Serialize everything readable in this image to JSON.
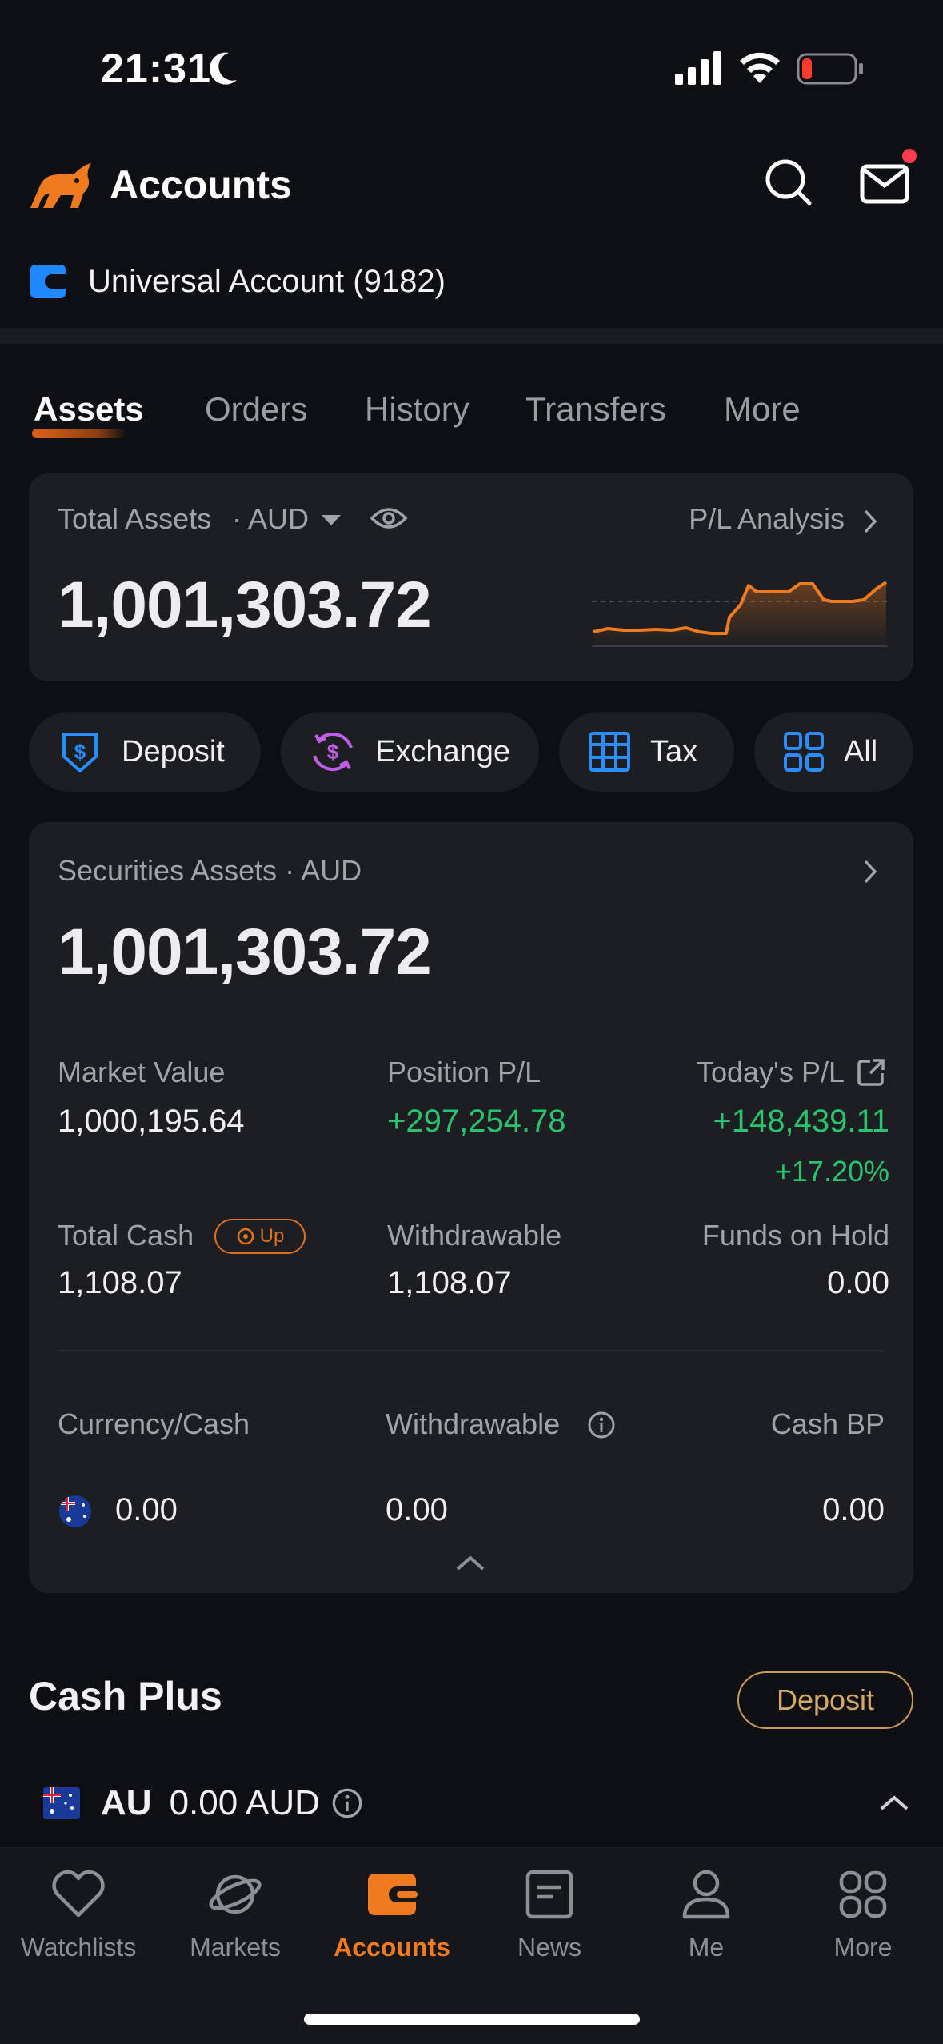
{
  "status_bar": {
    "time": "21:31"
  },
  "header": {
    "title": "Accounts"
  },
  "account": {
    "name": "Universal Account (9182)"
  },
  "tabs": [
    {
      "label": "Assets",
      "active": true
    },
    {
      "label": "Orders"
    },
    {
      "label": "History"
    },
    {
      "label": "Transfers"
    },
    {
      "label": "More"
    }
  ],
  "total_assets": {
    "label": "Total Assets",
    "currency": "· AUD",
    "value": "1,001,303.72",
    "pl_link": "P/L Analysis",
    "sparkline_color": "#f07a1f"
  },
  "actions": [
    {
      "label": "Deposit",
      "icon": "shield-dollar-icon"
    },
    {
      "label": "Exchange",
      "icon": "exchange-icon"
    },
    {
      "label": "Tax",
      "icon": "table-icon"
    },
    {
      "label": "All",
      "icon": "grid-icon"
    }
  ],
  "securities": {
    "label": "Securities Assets · AUD",
    "value": "1,001,303.72",
    "market_value_label": "Market Value",
    "market_value": "1,000,195.64",
    "position_pl_label": "Position P/L",
    "position_pl": "+297,254.78",
    "todays_pl_label": "Today's P/L",
    "todays_pl": "+148,439.11",
    "todays_pl_pct": "+17.20%",
    "total_cash_label": "Total Cash",
    "up_badge": "Up",
    "total_cash": "1,108.07",
    "withdrawable_label": "Withdrawable",
    "withdrawable": "1,108.07",
    "funds_on_hold_label": "Funds on Hold",
    "funds_on_hold": "0.00",
    "currency_cash_label": "Currency/Cash",
    "withdrawable2_label": "Withdrawable",
    "cash_bp_label": "Cash BP",
    "currency_cash": "0.00",
    "withdrawable2": "0.00",
    "cash_bp": "0.00"
  },
  "cash_plus": {
    "title": "Cash Plus",
    "deposit_label": "Deposit",
    "code": "AU",
    "amount": "0.00 AUD"
  },
  "bottom_nav": [
    {
      "label": "Watchlists"
    },
    {
      "label": "Markets"
    },
    {
      "label": "Accounts",
      "active": true
    },
    {
      "label": "News"
    },
    {
      "label": "Me"
    },
    {
      "label": "More"
    }
  ],
  "colors": {
    "accent": "#f07a1f",
    "positive": "#27c36f",
    "blue": "#1e88ff"
  }
}
